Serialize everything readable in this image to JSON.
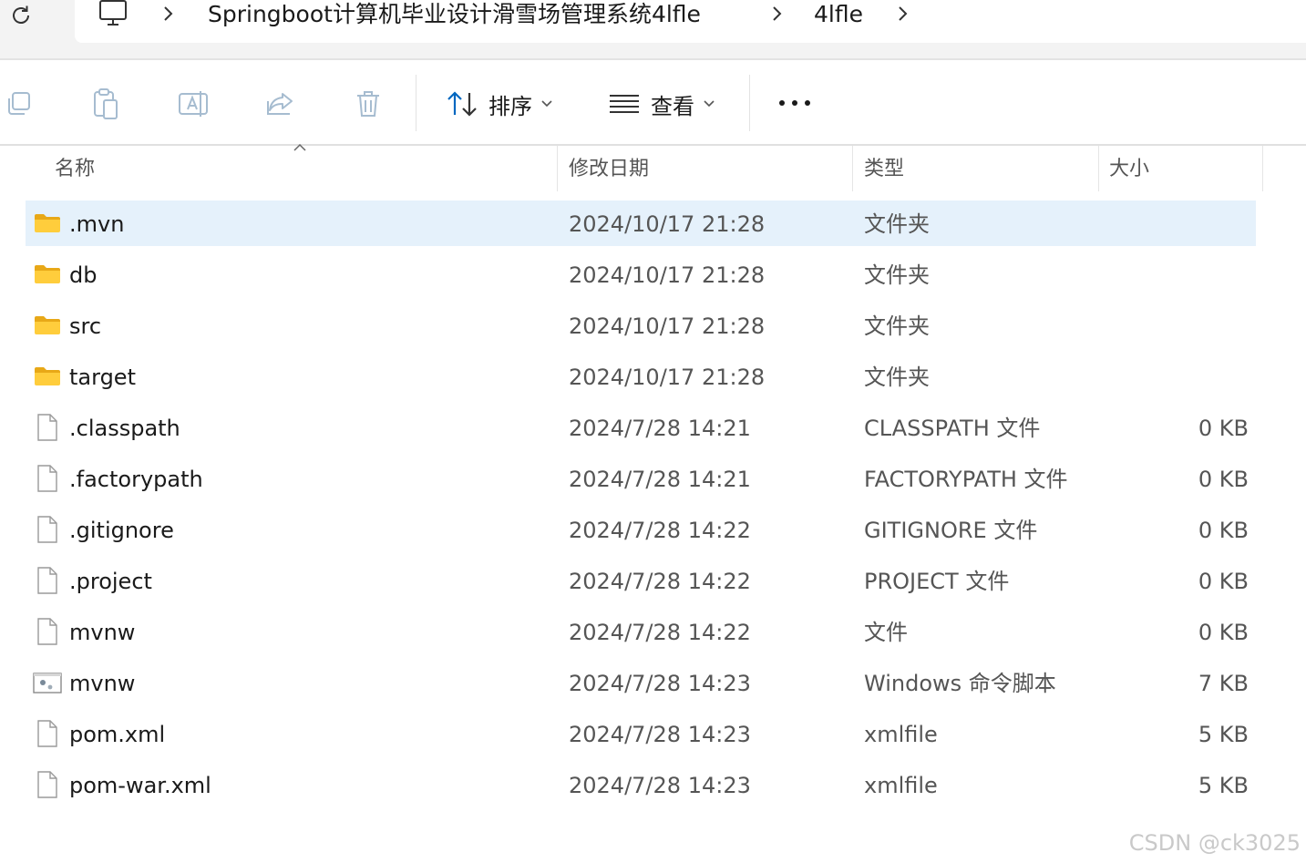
{
  "address_bar": {
    "crumbs": [
      "Springboot计算机毕业设计滑雪场管理系统4lfle",
      "4lfle"
    ]
  },
  "toolbar": {
    "sort_label": "排序",
    "view_label": "查看"
  },
  "columns": {
    "name": "名称",
    "date": "修改日期",
    "type": "类型",
    "size": "大小"
  },
  "files": [
    {
      "name": ".mvn",
      "date": "2024/10/17 21:28",
      "type": "文件夹",
      "size": "",
      "icon": "folder-icon",
      "selected": true
    },
    {
      "name": "db",
      "date": "2024/10/17 21:28",
      "type": "文件夹",
      "size": "",
      "icon": "folder-icon"
    },
    {
      "name": "src",
      "date": "2024/10/17 21:28",
      "type": "文件夹",
      "size": "",
      "icon": "folder-icon"
    },
    {
      "name": "target",
      "date": "2024/10/17 21:28",
      "type": "文件夹",
      "size": "",
      "icon": "folder-icon"
    },
    {
      "name": ".classpath",
      "date": "2024/7/28 14:21",
      "type": "CLASSPATH 文件",
      "size": "0 KB",
      "icon": "file-icon"
    },
    {
      "name": ".factorypath",
      "date": "2024/7/28 14:21",
      "type": "FACTORYPATH 文件",
      "size": "0 KB",
      "icon": "file-icon"
    },
    {
      "name": ".gitignore",
      "date": "2024/7/28 14:22",
      "type": "GITIGNORE 文件",
      "size": "0 KB",
      "icon": "file-icon"
    },
    {
      "name": ".project",
      "date": "2024/7/28 14:22",
      "type": "PROJECT 文件",
      "size": "0 KB",
      "icon": "file-icon"
    },
    {
      "name": "mvnw",
      "date": "2024/7/28 14:22",
      "type": "文件",
      "size": "0 KB",
      "icon": "file-icon"
    },
    {
      "name": "mvnw",
      "date": "2024/7/28 14:23",
      "type": "Windows 命令脚本",
      "size": "7 KB",
      "icon": "script-file-icon"
    },
    {
      "name": "pom.xml",
      "date": "2024/7/28 14:23",
      "type": "xmlfile",
      "size": "5 KB",
      "icon": "file-icon"
    },
    {
      "name": "pom-war.xml",
      "date": "2024/7/28 14:23",
      "type": "xmlfile",
      "size": "5 KB",
      "icon": "file-icon"
    }
  ],
  "watermark": "CSDN @ck3025"
}
